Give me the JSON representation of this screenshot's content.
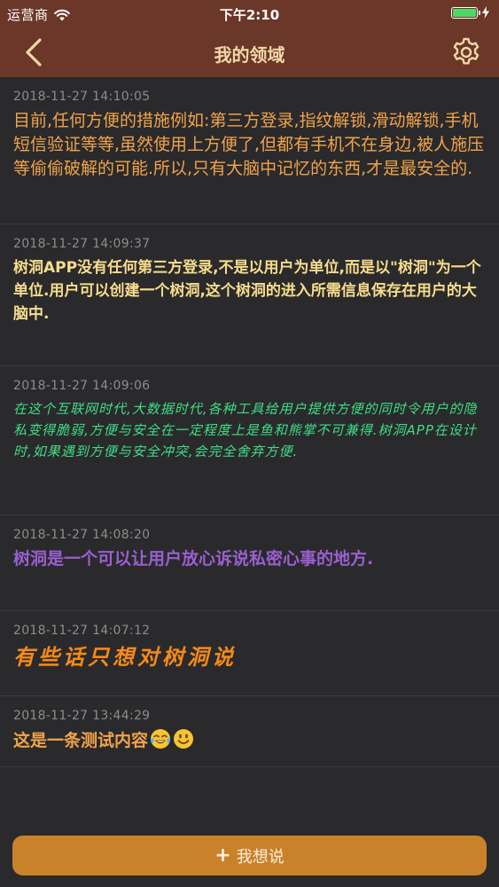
{
  "status": {
    "carrier": "运营商",
    "time": "下午2:10",
    "battery_level": 1.0
  },
  "nav": {
    "title": "我的领域",
    "back_icon": "chevron-left-icon",
    "settings_icon": "gear-icon"
  },
  "colors": {
    "nav_bg": "#6b3728",
    "body_bg": "#2a2a2c",
    "button_bg": "#c9822a"
  },
  "entries": [
    {
      "timestamp": "2018-11-27 14:10:05",
      "text": "目前,任何方便的措施例如:第三方登录,指纹解锁,滑动解锁,手机短信验证等等,虽然使用上方便了,但都有手机不在身边,被人施压等偷偷破解的可能.所以,只有大脑中记忆的东西,才是最安全的."
    },
    {
      "timestamp": "2018-11-27 14:09:37",
      "text": "树洞APP没有任何第三方登录,不是以用户为单位,而是以\"树洞\"为一个单位.用户可以创建一个树洞,这个树洞的进入所需信息保存在用户的大脑中."
    },
    {
      "timestamp": "2018-11-27 14:09:06",
      "text": "在这个互联网时代,大数据时代,各种工具给用户提供方便的同时令用户的隐私变得脆弱,方便与安全在一定程度上是鱼和熊掌不可兼得.树洞APP在设计时,如果遇到方便与安全冲突,会完全舍弃方便."
    },
    {
      "timestamp": "2018-11-27 14:08:20",
      "text": "树洞是一个可以让用户放心诉说私密心事的地方."
    },
    {
      "timestamp": "2018-11-27 14:07:12",
      "text": "有些话只想对树洞说"
    },
    {
      "timestamp": "2018-11-27 13:44:29",
      "text": "这是一条测试内容",
      "emojis": [
        "tears-of-joy-emoji-icon",
        "smiley-emoji-icon"
      ]
    }
  ],
  "footer": {
    "button_label": "我想说",
    "button_icon": "plus-icon"
  }
}
